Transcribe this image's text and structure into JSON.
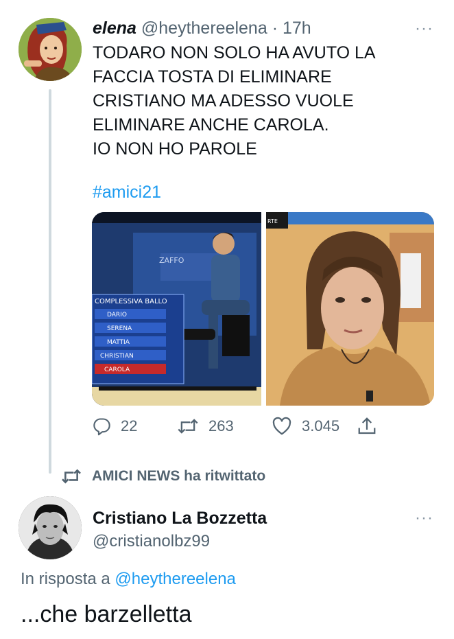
{
  "tweet": {
    "author_name": "elena",
    "author_handle": "@heythereelena",
    "separator": "·",
    "time": "17h",
    "text": "TODARO NON SOLO HA AVUTO LA\nFACCIA TOSTA DI ELIMINARE\nCRISTIANO MA ADESSO VUOLE\nELIMINARE ANCHE CAROLA.\nIO NON HO PAROLE",
    "hashtag": "#amici21",
    "more_label": "···",
    "media": {
      "left_overlay": {
        "board_title": "COMPLESSIVA BALLO",
        "board_names": [
          "DARIO",
          "SERENA",
          "MATTIA",
          "CHRISTIAN",
          "CAROLA"
        ],
        "tv_logo": "ZAFFO"
      },
      "right_overlay": {
        "corner_text": "RTE"
      }
    },
    "actions": {
      "replies": "22",
      "retweets": "263",
      "likes": "3.045"
    }
  },
  "retweet_notice": {
    "text": "AMICI NEWS ha ritwittato"
  },
  "reply": {
    "author_name": "Cristiano La Bozzetta",
    "author_handle": "@cristianolbz99",
    "more_label": "···",
    "reply_prefix": "In risposta a ",
    "reply_mention": "@heythereelena",
    "text": "...che barzelletta"
  },
  "colors": {
    "text_primary": "#0f1419",
    "text_secondary": "#536471",
    "accent": "#1d9bf0",
    "thread_line": "#cfd9de"
  }
}
